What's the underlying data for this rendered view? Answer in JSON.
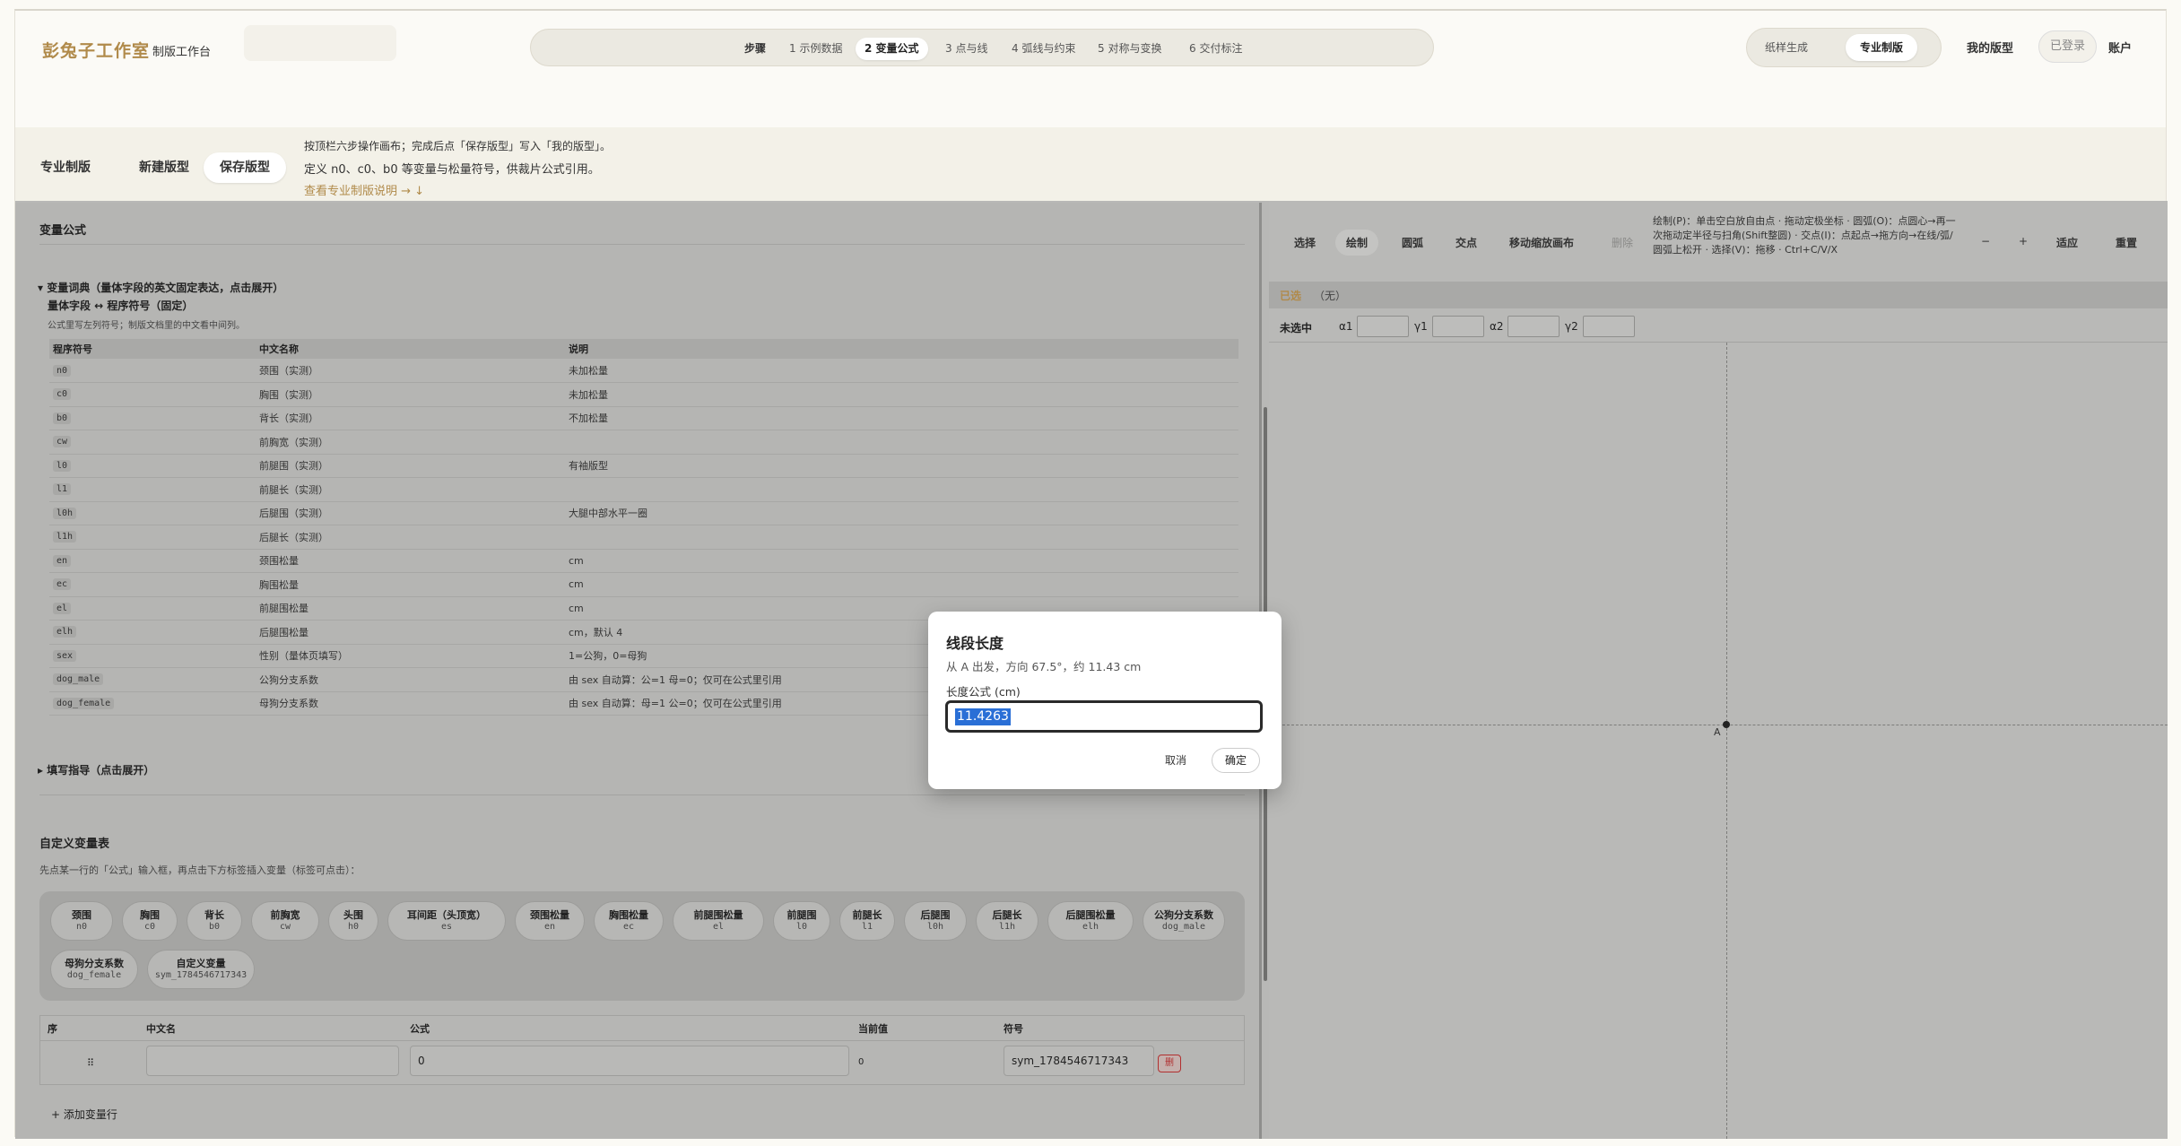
{
  "brand": {
    "name": "彭兔子工作室",
    "subtitle": "制版工作台"
  },
  "steps": {
    "lead": "步骤",
    "items": [
      "1 示例数据",
      "2 变量公式",
      "3 点与线",
      "4 弧线与约束",
      "5 对称与变换",
      "6 交付标注"
    ],
    "active_index": 1
  },
  "modes": {
    "paper": "纸样生成",
    "pro": "专业制版",
    "active": "专业制版"
  },
  "nav": {
    "my_patterns": "我的版型",
    "logged_in": "已登录",
    "account": "账户"
  },
  "subbar": {
    "tabs": [
      "专业制版",
      "新建版型",
      "保存版型"
    ],
    "active_tab": "保存版型",
    "hint_line1": "按顶栏六步操作画布；完成后点「保存版型」写入「我的版型」。",
    "hint_line2": "定义 n0、c0、b0 等变量与松量符号，供裁片公式引用。",
    "hint_link": "查看专业制版说明 → ↓"
  },
  "variables_panel": {
    "title": "变量公式",
    "dict_summary": "▾ 变量词典（量体字段的英文固定表达，点击展开）",
    "dict_subtitle": "量体字段 ↔ 程序符号（固定）",
    "dict_desc": "公式里写左列符号；制版文档里的中文看中间列。",
    "columns": [
      "程序符号",
      "中文名称",
      "说明"
    ],
    "rows": [
      [
        "n0",
        "颈围（实测）",
        "未加松量"
      ],
      [
        "c0",
        "胸围（实测）",
        "未加松量"
      ],
      [
        "b0",
        "背长（实测）",
        "不加松量"
      ],
      [
        "cw",
        "前胸宽（实测）",
        ""
      ],
      [
        "l0",
        "前腿围（实测）",
        "有袖版型"
      ],
      [
        "l1",
        "前腿长（实测）",
        ""
      ],
      [
        "l0h",
        "后腿围（实测）",
        "大腿中部水平一圈"
      ],
      [
        "l1h",
        "后腿长（实测）",
        ""
      ],
      [
        "en",
        "颈围松量",
        "cm"
      ],
      [
        "ec",
        "胸围松量",
        "cm"
      ],
      [
        "el",
        "前腿围松量",
        "cm"
      ],
      [
        "elh",
        "后腿围松量",
        "cm，默认 4"
      ],
      [
        "sex",
        "性别（量体页填写）",
        "1=公狗，0=母狗"
      ],
      [
        "dog_male",
        "公狗分支系数",
        "由 sex 自动算：公=1 母=0；仅可在公式里引用"
      ],
      [
        "dog_female",
        "母狗分支系数",
        "由 sex 自动算：母=1 公=0；仅可在公式里引用"
      ]
    ],
    "guide_summary": "▸ 填写指导（点击展开）",
    "custom_title": "自定义变量表",
    "custom_desc": "先点某一行的「公式」输入框，再点击下方标签插入变量（标签可点击）：",
    "chips": [
      {
        "cn": "颈围",
        "code": "n0"
      },
      {
        "cn": "胸围",
        "code": "c0"
      },
      {
        "cn": "背长",
        "code": "b0"
      },
      {
        "cn": "前胸宽",
        "code": "cw"
      },
      {
        "cn": "头围",
        "code": "h0"
      },
      {
        "cn": "耳间距（头顶宽）",
        "code": "es"
      },
      {
        "cn": "颈围松量",
        "code": "en"
      },
      {
        "cn": "胸围松量",
        "code": "ec"
      },
      {
        "cn": "前腿围松量",
        "code": "el"
      },
      {
        "cn": "前腿围",
        "code": "l0"
      },
      {
        "cn": "前腿长",
        "code": "l1"
      },
      {
        "cn": "后腿围",
        "code": "l0h"
      },
      {
        "cn": "后腿长",
        "code": "l1h"
      },
      {
        "cn": "后腿围松量",
        "code": "elh"
      },
      {
        "cn": "公狗分支系数",
        "code": "dog_male"
      },
      {
        "cn": "母狗分支系数",
        "code": "dog_female"
      },
      {
        "cn": "自定义变量",
        "code": "sym_1784546717343"
      }
    ],
    "var_table": {
      "columns": [
        "序",
        "中文名",
        "公式",
        "当前值",
        "符号"
      ],
      "row": {
        "index": "⠿",
        "name": "",
        "formula": "0",
        "value": "0",
        "symbol": "sym_1784546717343",
        "delete": "删"
      }
    },
    "add_row": "+ 添加变量行"
  },
  "canvas_panel": {
    "tools": [
      "选择",
      "绘制",
      "圆弧",
      "交点",
      "移动缩放画布",
      "删除"
    ],
    "active_tool": "绘制",
    "help": "绘制(P)：单击空白放自由点 · 拖动定极坐标 · 圆弧(O)：点圆心→再一次拖动定半径与扫角(Shift整圆) · 交点(I)：点起点→拖方向→在线/弧/圆弧上松开 · 选择(V)：拖移 · Ctrl+C/V/X",
    "zoom_out": "−",
    "zoom_in": "+",
    "fit": "适应",
    "reset": "重置",
    "selected_label": "已选",
    "selected_value": "（无）",
    "unselected": "未选中",
    "coords": [
      "α1",
      "γ1",
      "α2",
      "γ2"
    ],
    "origin_label": "A"
  },
  "modal": {
    "title": "线段长度",
    "desc": "从 A 出发，方向 67.5°，约 11.43 cm",
    "label": "长度公式 (cm)",
    "value": "11.4263",
    "cancel": "取消",
    "ok": "确定"
  }
}
